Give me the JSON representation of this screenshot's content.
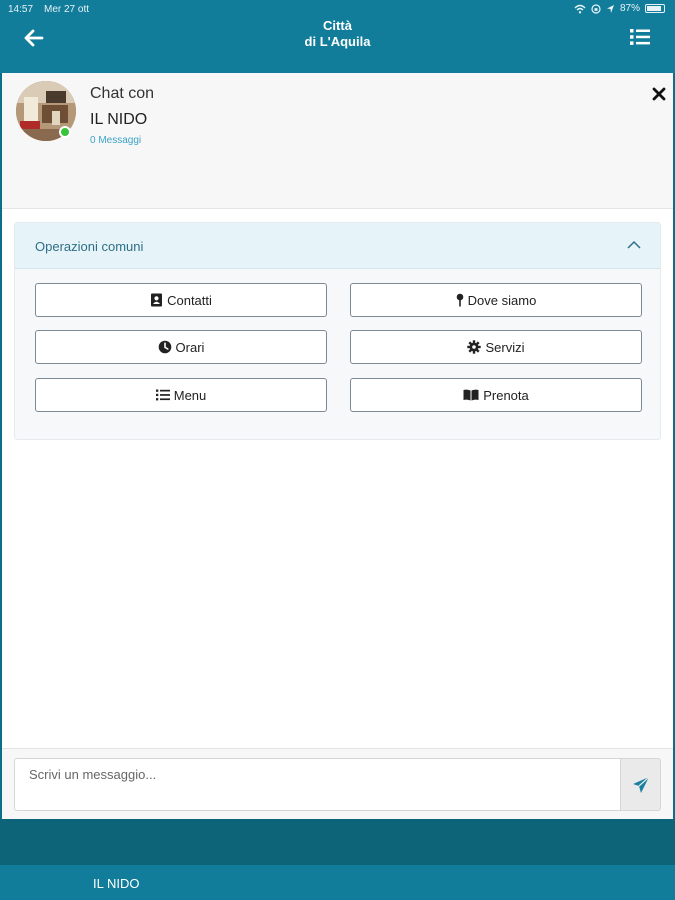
{
  "status": {
    "time": "14:57",
    "date": "Mer 27 ott",
    "battery": "87%"
  },
  "header": {
    "title_line1": "Città",
    "title_line2": "di L'Aquila",
    "back_icon": "arrow-left-icon",
    "menu_icon": "list-icon"
  },
  "chat": {
    "with_label": "Chat con",
    "name": "IL NIDO",
    "message_count": "0 Messaggi",
    "online_color": "#37c33a"
  },
  "operations": {
    "title": "Operazioni comuni",
    "buttons": [
      {
        "label": "Contatti",
        "icon": "address-book-icon"
      },
      {
        "label": "Dove siamo",
        "icon": "map-pin-icon"
      },
      {
        "label": "Orari",
        "icon": "clock-icon"
      },
      {
        "label": "Servizi",
        "icon": "gear-icon"
      },
      {
        "label": "Menu",
        "icon": "list-icon"
      },
      {
        "label": "Prenota",
        "icon": "book-icon"
      }
    ]
  },
  "composer": {
    "placeholder": "Scrivi un messaggio...",
    "send_icon": "send-icon"
  },
  "tabbar": {
    "item": "IL NIDO"
  },
  "colors": {
    "brand": "#117d9b",
    "brand_dark": "#0d6377",
    "accent_text": "#3aa3c7"
  }
}
